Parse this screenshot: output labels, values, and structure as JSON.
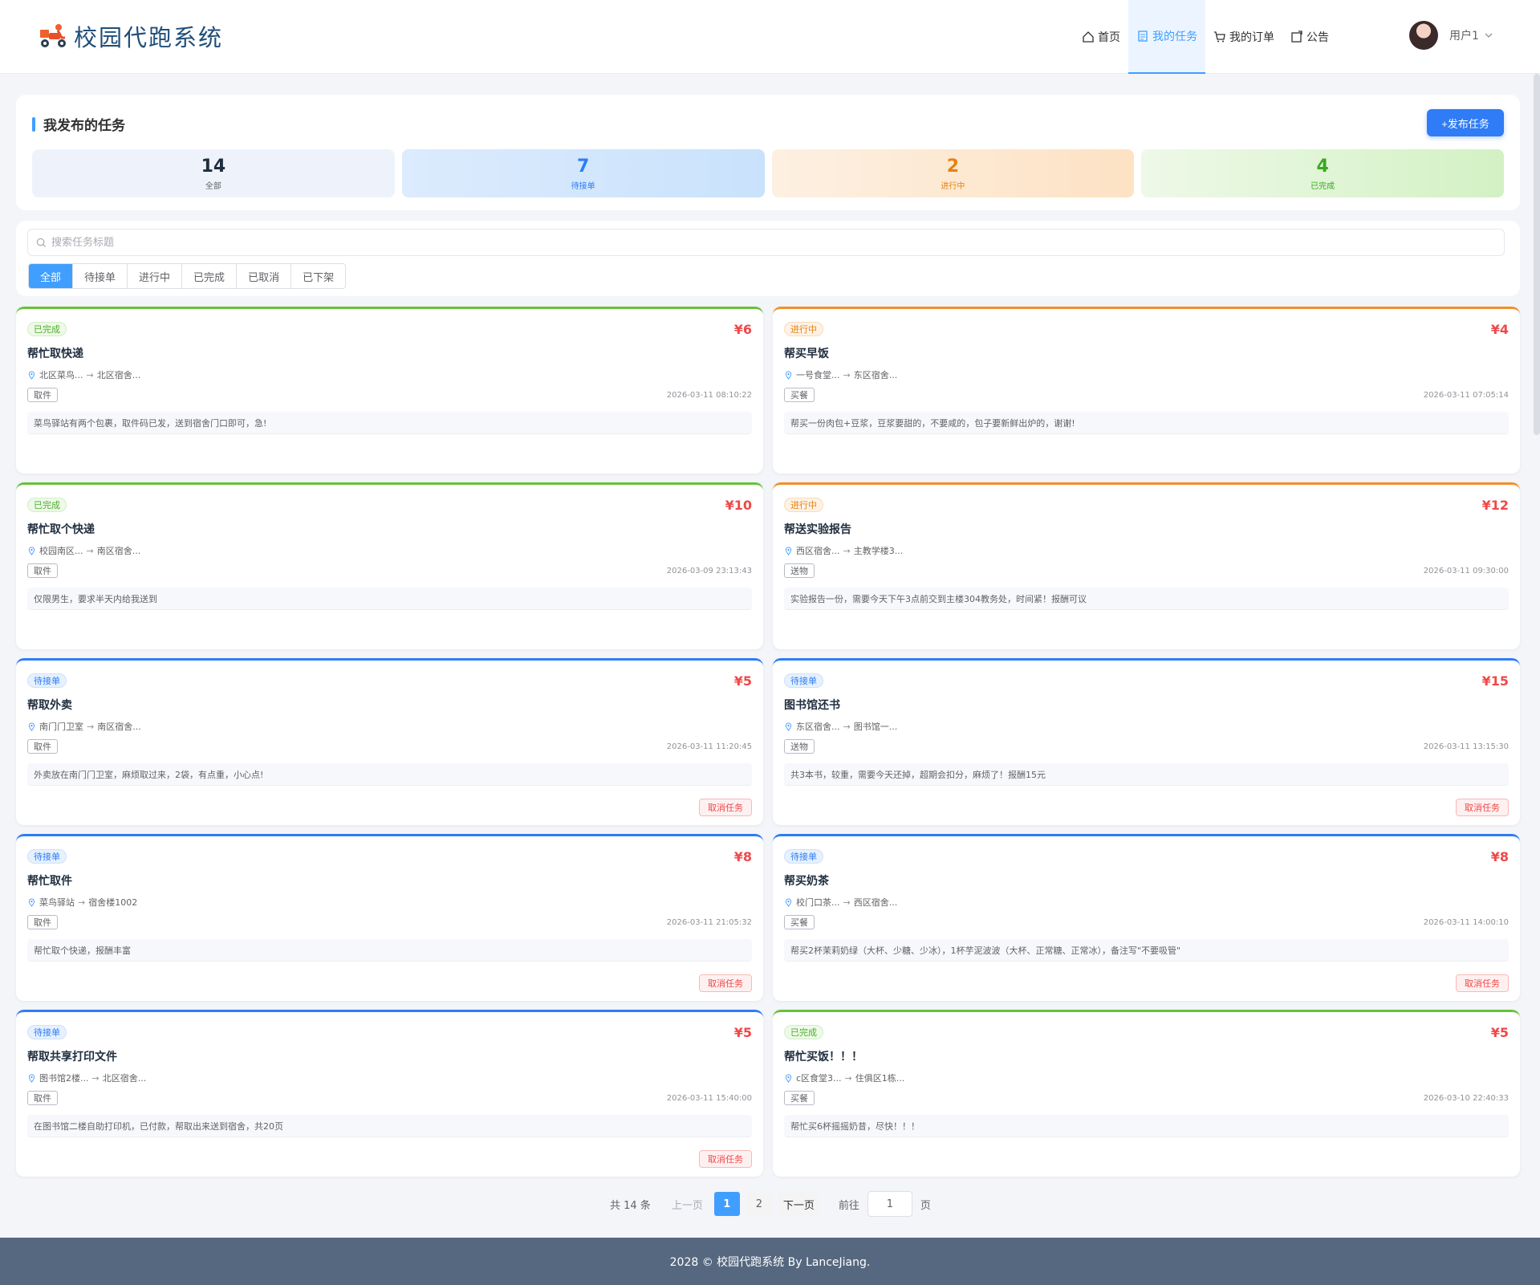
{
  "header": {
    "logo_text": "校园代跑系统",
    "nav": [
      {
        "label": "首页",
        "icon": "home-icon"
      },
      {
        "label": "我的任务",
        "icon": "document-icon",
        "active": true
      },
      {
        "label": "我的订单",
        "icon": "cart-icon"
      },
      {
        "label": "公告",
        "icon": "announcement-icon"
      }
    ],
    "user_name": "用户1"
  },
  "summary": {
    "title": "我发布的任务",
    "publish_button": "+发布任务",
    "stats": [
      {
        "num": "14",
        "label": "全部"
      },
      {
        "num": "7",
        "label": "待接单"
      },
      {
        "num": "2",
        "label": "进行中"
      },
      {
        "num": "4",
        "label": "已完成"
      }
    ]
  },
  "filter": {
    "search_placeholder": "搜索任务标题",
    "tabs": [
      "全部",
      "待接单",
      "进行中",
      "已完成",
      "已取消",
      "已下架"
    ],
    "active_tab": "全部"
  },
  "tasks": [
    {
      "status": "已完成",
      "price": "¥6",
      "title": "帮忙取快递",
      "from": "北区菜鸟...",
      "to": "北区宿舍...",
      "type": "取件",
      "time": "2026-03-11 08:10:22",
      "desc": "菜鸟驿站有两个包裹，取件码已发，送到宿舍门口即可，急!"
    },
    {
      "status": "进行中",
      "price": "¥4",
      "title": "帮买早饭",
      "from": "一号食堂...",
      "to": "东区宿舍...",
      "type": "买餐",
      "time": "2026-03-11 07:05:14",
      "desc": "帮买一份肉包+豆浆，豆浆要甜的，不要咸的，包子要新鲜出炉的，谢谢!"
    },
    {
      "status": "已完成",
      "price": "¥10",
      "title": "帮忙取个快递",
      "from": "校园南区...",
      "to": "南区宿舍...",
      "type": "取件",
      "time": "2026-03-09 23:13:43",
      "desc": "仅限男生，要求半天内给我送到"
    },
    {
      "status": "进行中",
      "price": "¥12",
      "title": "帮送实验报告",
      "from": "西区宿舍...",
      "to": "主教学楼3...",
      "type": "送物",
      "time": "2026-03-11 09:30:00",
      "desc": "实验报告一份，需要今天下午3点前交到主楼304教务处，时间紧！报酬可议"
    },
    {
      "status": "待接单",
      "price": "¥5",
      "title": "帮取外卖",
      "from": "南门门卫室",
      "to": "南区宿舍...",
      "type": "取件",
      "time": "2026-03-11 11:20:45",
      "desc": "外卖放在南门门卫室，麻烦取过来，2袋，有点重，小心点!",
      "cancel": "取消任务"
    },
    {
      "status": "待接单",
      "price": "¥15",
      "title": "图书馆还书",
      "from": "东区宿舍...",
      "to": "图书馆一...",
      "type": "送物",
      "time": "2026-03-11 13:15:30",
      "desc": "共3本书，较重，需要今天还掉，超期会扣分，麻烦了！报酬15元",
      "cancel": "取消任务"
    },
    {
      "status": "待接单",
      "price": "¥8",
      "title": "帮忙取件",
      "from": "菜鸟驿站",
      "to": "宿舍楼1002",
      "type": "取件",
      "time": "2026-03-11 21:05:32",
      "desc": "帮忙取个快递，报酬丰富",
      "cancel": "取消任务"
    },
    {
      "status": "待接单",
      "price": "¥8",
      "title": "帮买奶茶",
      "from": "校门口茶...",
      "to": "西区宿舍...",
      "type": "买餐",
      "time": "2026-03-11 14:00:10",
      "desc": "帮买2杯茉莉奶绿（大杯、少糖、少冰），1杯芋泥波波（大杯、正常糖、正常冰），备注写\"不要吸管\"",
      "cancel": "取消任务"
    },
    {
      "status": "待接单",
      "price": "¥5",
      "title": "帮取共享打印文件",
      "from": "图书馆2楼...",
      "to": "北区宿舍...",
      "type": "取件",
      "time": "2026-03-11 15:40:00",
      "desc": "在图书馆二楼自助打印机，已付款，帮取出来送到宿舍，共20页",
      "cancel": "取消任务"
    },
    {
      "status": "已完成",
      "price": "¥5",
      "title": "帮忙买饭！！！",
      "from": "c区食堂3...",
      "to": "住俱区1栋...",
      "type": "买餐",
      "time": "2026-03-10 22:40:33",
      "desc": "帮忙买6杯摇摇奶昔，尽快！！！"
    }
  ],
  "pagination": {
    "total": "共 14 条",
    "prev": "上一页",
    "pages": [
      "1",
      "2"
    ],
    "current": "1",
    "next": "下一页",
    "goto": "前往",
    "goto_value": "1",
    "page_suffix": "页"
  },
  "footer": {
    "text": "2028 © 校园代跑系统 By LanceJiang."
  },
  "colors": {
    "primary": "#409eff",
    "done": "#67c23a",
    "progress": "#f0902a",
    "pending": "#2f7cf6",
    "price": "#f04848",
    "footer": "#56687f"
  }
}
